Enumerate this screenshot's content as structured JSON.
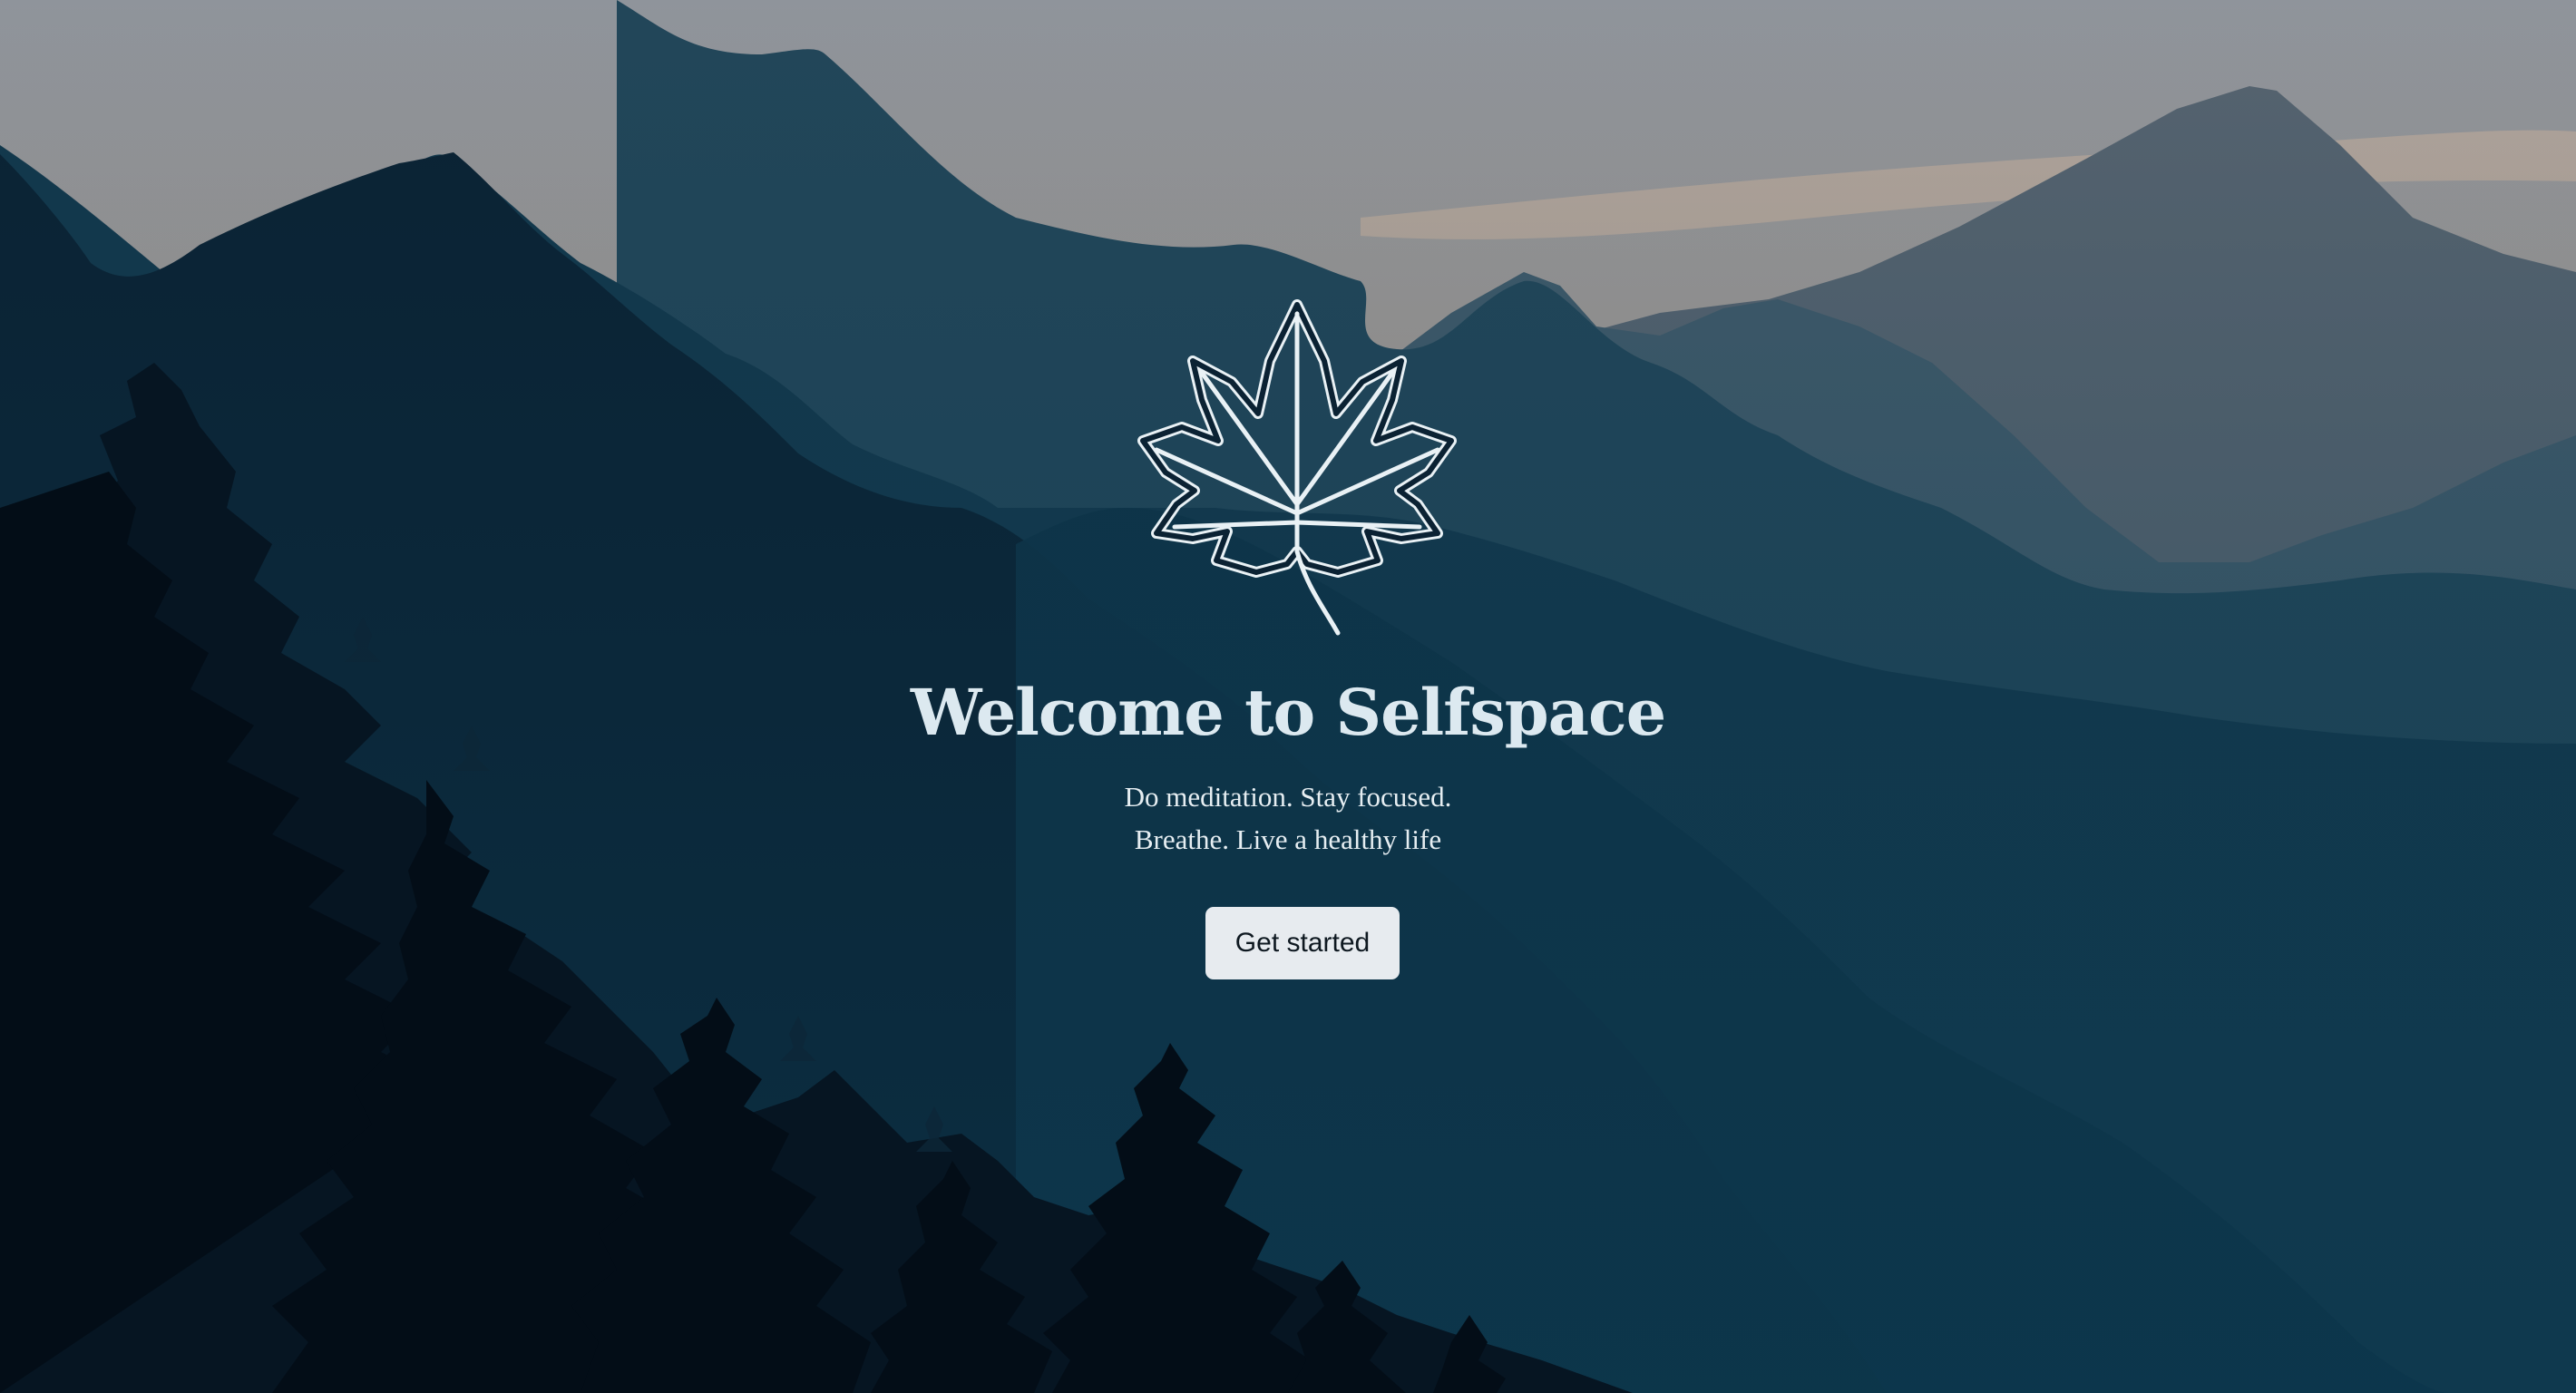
{
  "hero": {
    "logo_icon": "maple-leaf-icon",
    "title": "Welcome to Selfspace",
    "tagline_line1": "Do meditation. Stay focused.",
    "tagline_line2": "Breathe. Live a healthy life",
    "cta_label": "Get started"
  },
  "background": {
    "description_icon": "mountain-landscape",
    "sky_top": "#8e939a",
    "sky_horizon": "#c9a68c",
    "far_range": "#52616d",
    "near_range": "#0b2334",
    "foreground": "#04101b"
  }
}
